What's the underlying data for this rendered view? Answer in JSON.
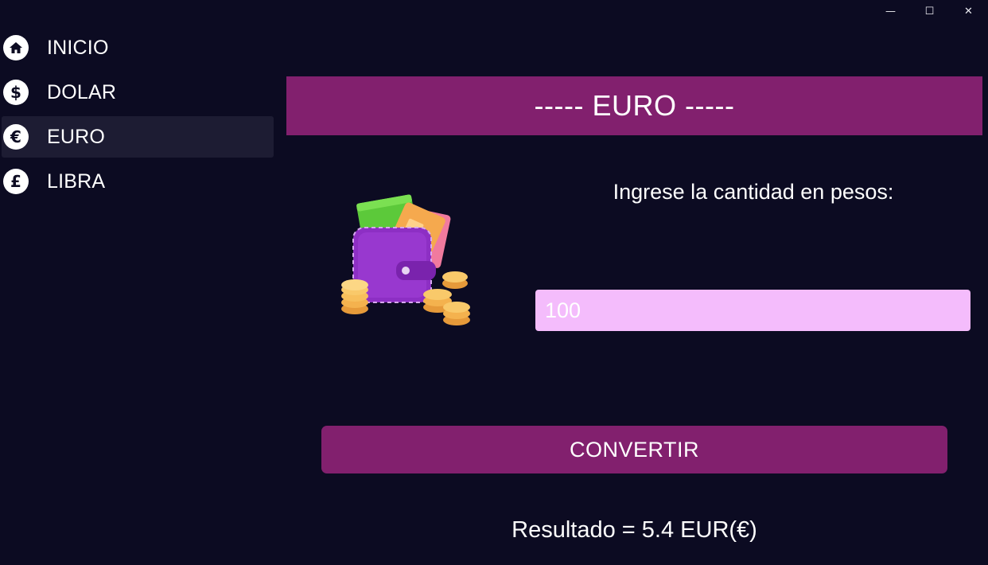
{
  "window": {
    "minimize_glyph": "—",
    "maximize_glyph": "☐",
    "close_glyph": "✕"
  },
  "sidebar": {
    "items": [
      {
        "label": "INICIO",
        "icon": "home-icon",
        "glyph": "⌂",
        "active": false
      },
      {
        "label": "DOLAR",
        "icon": "dollar-icon",
        "glyph": "$",
        "active": false
      },
      {
        "label": "EURO",
        "icon": "euro-icon",
        "glyph": "€",
        "active": true
      },
      {
        "label": "LIBRA",
        "icon": "pound-icon",
        "glyph": "£",
        "active": false
      }
    ]
  },
  "main": {
    "title": "----- EURO -----",
    "prompt": "Ingrese la cantidad en pesos:",
    "amount_value": "100",
    "convert_label": "CONVERTIR",
    "result": "Resultado = 5.4 EUR(€)",
    "illustration": "wallet-with-coins"
  },
  "colors": {
    "background": "#0c0b22",
    "accent": "#82206e",
    "input_bg": "#f4bcfc",
    "active_nav": "#1d1c33"
  }
}
